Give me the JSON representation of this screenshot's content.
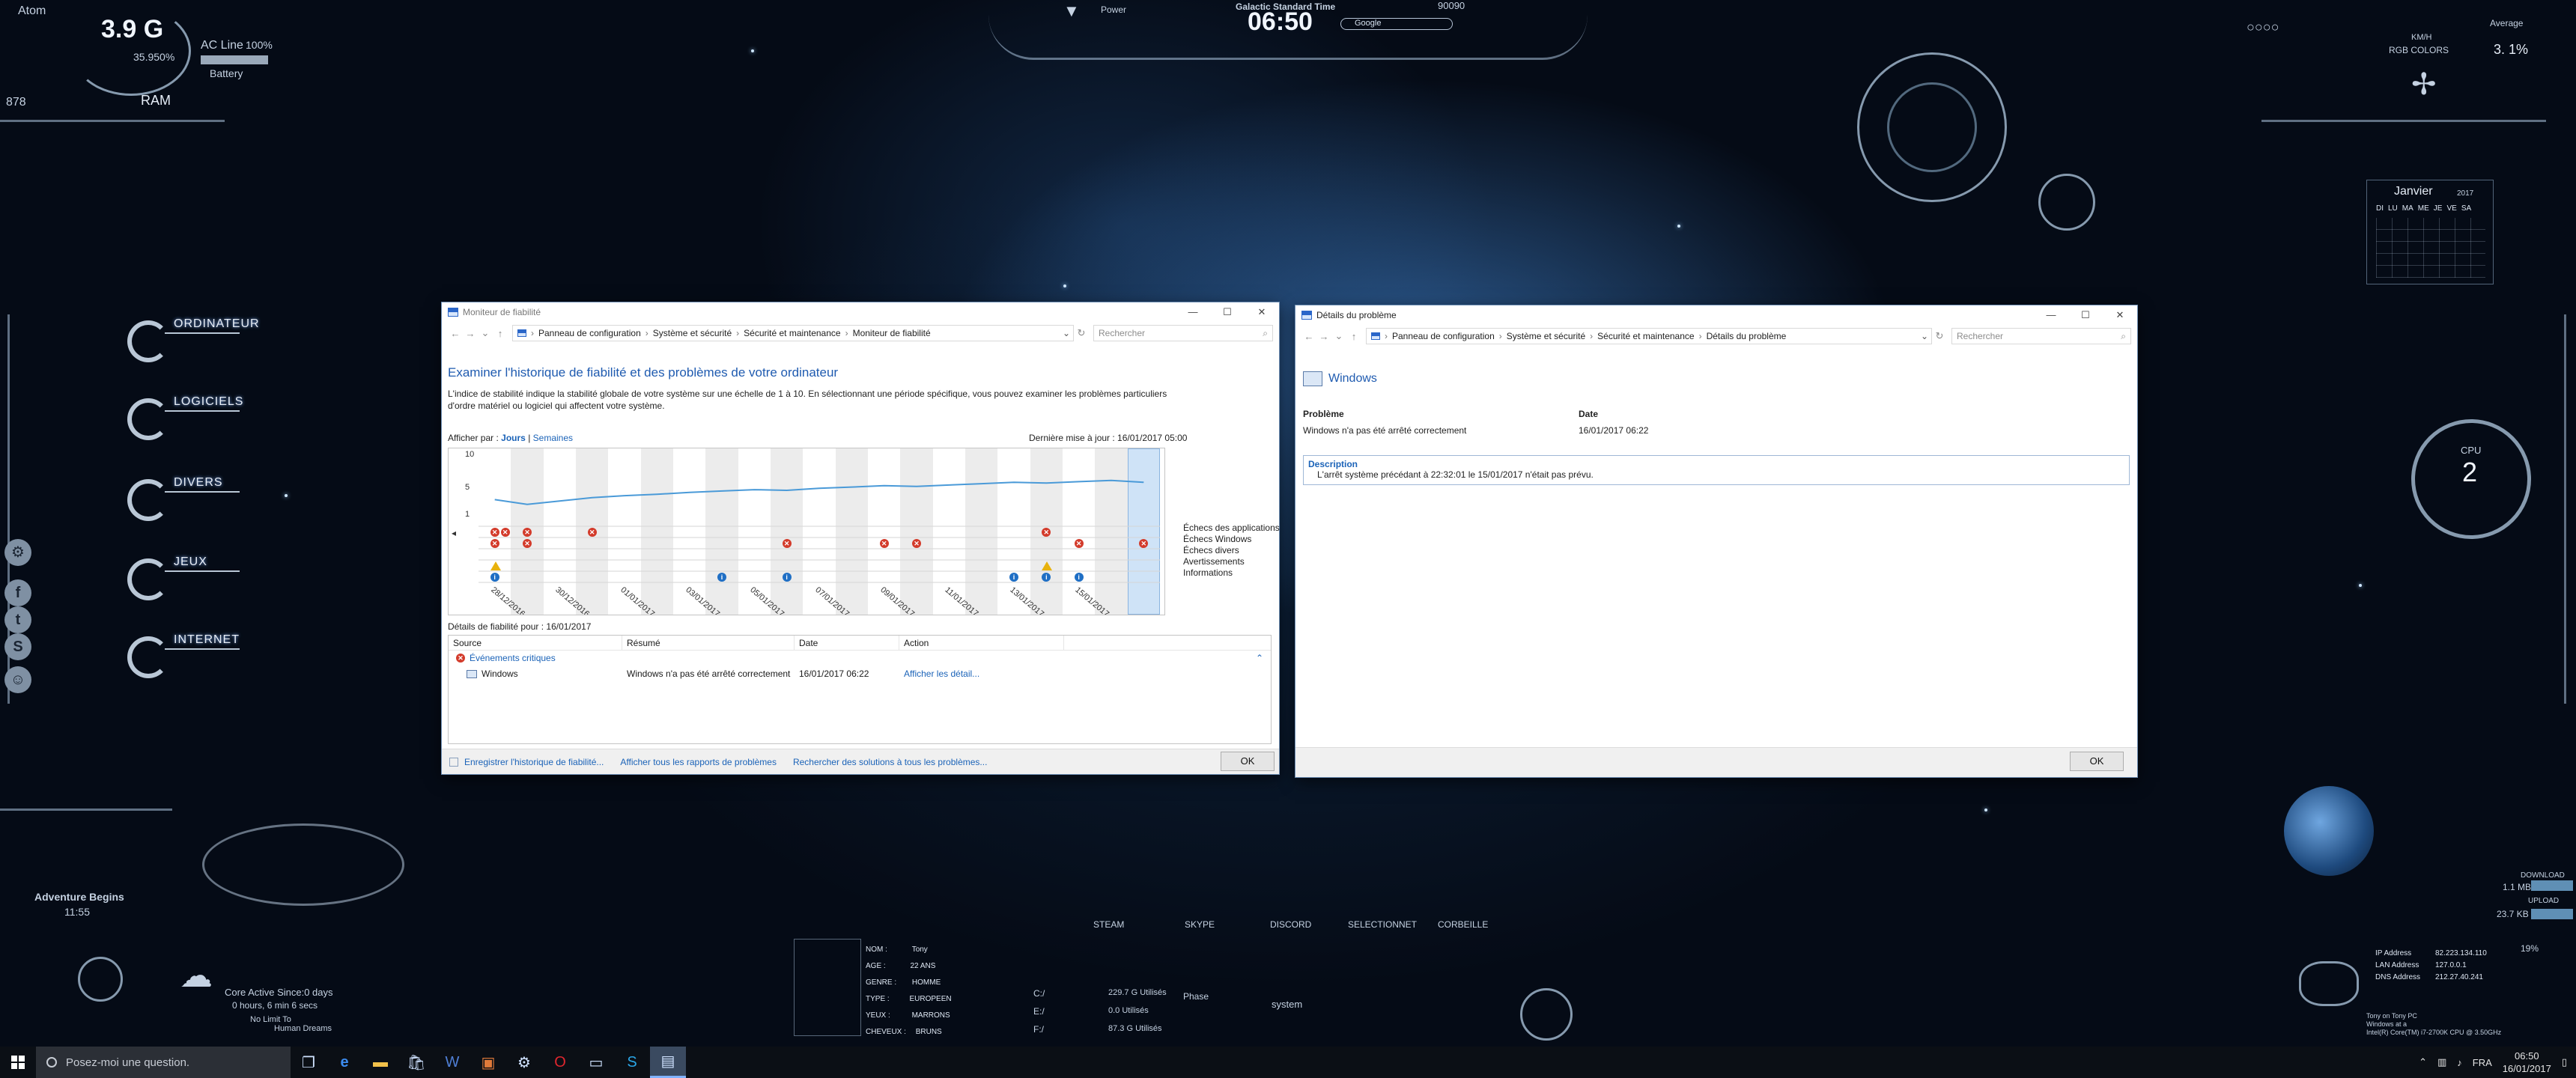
{
  "desktop": {
    "top_left": {
      "user": "Atom",
      "ram_value": "3.9 G",
      "ram_label": "RAM",
      "sub_value": "35.950%",
      "power_line": "AC Line",
      "power_pct": "100%",
      "battery_label": "Battery",
      "counter": "878"
    },
    "top_center": {
      "power_label": "Power",
      "clock_title": "Galactic Standard Time",
      "clock_time": "06:50",
      "search_placeholder": "Google",
      "counter": "90090"
    },
    "top_right": {
      "cpu_avg_label": "Average",
      "cpu_avg": "3. 1%",
      "kmh_label": "KM/H",
      "rgb_label": "RGB COLORS"
    },
    "calendar": {
      "month": "Janvier",
      "year": "2017",
      "days": [
        "DI",
        "LU",
        "MA",
        "ME",
        "JE",
        "VE",
        "SA"
      ]
    },
    "cpu_gauge": {
      "label": "CPU",
      "value": "2"
    },
    "left_nav": [
      "ORDINATEUR",
      "LOGICIELS",
      "DIVERS",
      "JEUX",
      "INTERNET"
    ],
    "social_icons": [
      "steam-icon",
      "facebook-icon",
      "twitter-icon",
      "skype-icon",
      "group-icon"
    ],
    "bottom_left": {
      "adventure_title": "Adventure Begins",
      "adventure_time": "11:55",
      "core_active": "Core Active Since:0 days",
      "uptime": "0 hours, 6 min 6 secs",
      "tagline1": "No Limit To",
      "tagline2": "Human Dreams"
    },
    "bottom_center": {
      "profile": [
        [
          "NOM",
          "Tony"
        ],
        [
          "AGE",
          "22 ANS"
        ],
        [
          "GENRE",
          "HOMME"
        ],
        [
          "TYPE",
          "EUROPEEN"
        ],
        [
          "YEUX",
          "MARRONS"
        ],
        [
          "CHEVEUX",
          "BRUNS"
        ]
      ],
      "drives": [
        [
          "C:/",
          "229.7 G Utilisés"
        ],
        [
          "E:/",
          "0.0 Utilisés"
        ],
        [
          "F:/",
          "87.3 G Utilisés"
        ]
      ],
      "phase_label": "Phase",
      "system_label": "system",
      "launchers": [
        "STEAM",
        "SKYPE",
        "DISCORD",
        "SELECTIONNET",
        "CORBEILLE"
      ]
    },
    "bottom_right": {
      "download_label": "DOWNLOAD",
      "download_value": "1.1 MB",
      "upload_label": "UPLOAD",
      "upload_value": "23.7 KB",
      "pct": "19%",
      "ip_rows": [
        [
          "IP Address",
          "82.223.134.110"
        ],
        [
          "LAN Address",
          "127.0.0.1"
        ],
        [
          "DNS Address",
          "212.27.40.241"
        ]
      ],
      "device_lines": [
        "Tony on Tony PC",
        "Windows at a",
        "Intel(R) Core(TM) i7-2700K CPU @ 3.50GHz"
      ]
    }
  },
  "reliability_window": {
    "title": "Moniteur de fiabilité",
    "controls": {
      "minimize": "—",
      "maximize": "☐",
      "close": "✕"
    },
    "breadcrumbs": [
      "Panneau de configuration",
      "Système et sécurité",
      "Sécurité et maintenance",
      "Moniteur de fiabilité"
    ],
    "search_placeholder": "Rechercher",
    "heading": "Examiner l'historique de fiabilité et des problèmes de votre ordinateur",
    "intro": "L'indice de stabilité indique la stabilité globale de votre système sur une échelle de 1 à 10. En sélectionnant une période spécifique, vous pouvez examiner les problèmes particuliers d'ordre matériel ou logiciel qui affectent votre système.",
    "view_by_label": "Afficher par :",
    "view_days": "Jours",
    "view_sep": "|",
    "view_weeks": "Semaines",
    "last_update": "Dernière mise à jour : 16/01/2017 05:00",
    "chart_data": {
      "type": "line",
      "y_ticks": [
        "10",
        "5",
        "1"
      ],
      "ylim": [
        1,
        10
      ],
      "dates": [
        "28/12/2016",
        "30/12/2016",
        "01/01/2017",
        "03/01/2017",
        "05/01/2017",
        "07/01/2017",
        "09/01/2017",
        "11/01/2017",
        "13/01/2017",
        "15/01/2017"
      ],
      "days": 21,
      "stability": [
        3.2,
        2.5,
        3.0,
        3.5,
        3.8,
        4.0,
        4.3,
        4.5,
        4.7,
        4.6,
        4.9,
        5.1,
        5.3,
        5.2,
        5.4,
        5.6,
        5.8,
        5.7,
        5.9,
        6.1,
        5.8
      ],
      "selected_day": 20,
      "categories": [
        "Échecs des applications",
        "Échecs Windows",
        "Échecs divers",
        "Avertissements",
        "Informations"
      ],
      "events": {
        "app_failures": [
          0,
          1,
          3,
          17
        ],
        "windows_failures": [
          0,
          1,
          9,
          12,
          13,
          18,
          20
        ],
        "warnings": [
          0,
          17
        ],
        "informations": [
          0,
          7,
          9,
          16,
          17,
          18
        ]
      }
    },
    "details_label": "Détails de fiabilité pour : 16/01/2017",
    "table": {
      "headers": [
        "Source",
        "Résumé",
        "Date",
        "Action"
      ],
      "group": "Événements critiques",
      "rows": [
        {
          "source": "Windows",
          "summary": "Windows n'a pas été arrêté correctement",
          "date": "16/01/2017 06:22",
          "action": "Afficher les détail..."
        }
      ]
    },
    "footer_links": [
      "Enregistrer l'historique de fiabilité...",
      "Afficher tous les rapports de problèmes",
      "Rechercher des solutions à tous les problèmes..."
    ],
    "ok": "OK"
  },
  "problem_window": {
    "title": "Détails du problème",
    "controls": {
      "minimize": "—",
      "maximize": "☐",
      "close": "✕"
    },
    "breadcrumbs": [
      "Panneau de configuration",
      "Système et sécurité",
      "Sécurité et maintenance",
      "Détails du problème"
    ],
    "search_placeholder": "Rechercher",
    "app_name": "Windows",
    "problem_label": "Problème",
    "problem_value": "Windows n'a pas été arrêté correctement",
    "date_label": "Date",
    "date_value": "16/01/2017 06:22",
    "description_label": "Description",
    "description_value": "L'arrêt système précédant à 22:32:01 le 15/01/2017 n'était pas prévu.",
    "ok": "OK"
  },
  "taskbar": {
    "search_placeholder": "Posez-moi une question.",
    "apps": [
      "task-view-icon",
      "edge-icon",
      "explorer-icon",
      "store-icon",
      "word-icon",
      "app-icon",
      "steam-icon",
      "opera-icon",
      "monitor-icon",
      "skype-icon",
      "reliability-icon"
    ],
    "language": "FRA",
    "time": "06:50",
    "date": "16/01/2017"
  }
}
